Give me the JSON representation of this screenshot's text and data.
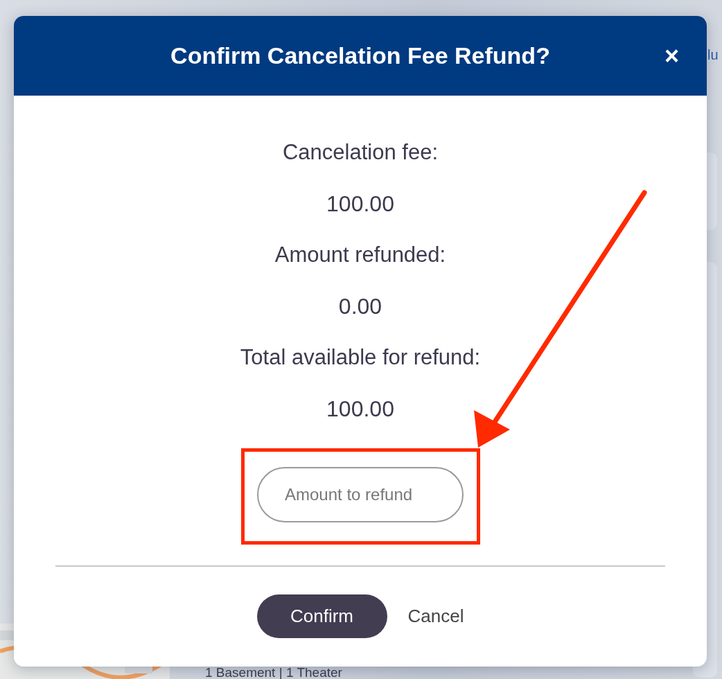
{
  "background_page": {
    "edge_link": "lu",
    "bottom_text": "1 Basement | 1 Theater"
  },
  "dialog": {
    "title": "Confirm Cancelation Fee Refund?",
    "close": "×",
    "lines": [
      {
        "kind": "label",
        "text": "Cancelation fee:"
      },
      {
        "kind": "value",
        "text": "100.00"
      },
      {
        "kind": "label",
        "text": "Amount refunded:"
      },
      {
        "kind": "value",
        "text": "0.00"
      },
      {
        "kind": "label",
        "text": "Total available for refund:"
      },
      {
        "kind": "value",
        "text": "100.00"
      }
    ],
    "refund_field": {
      "placeholder": "Amount to refund"
    },
    "buttons": [
      {
        "kind": "primary",
        "label": "Confirm"
      },
      {
        "kind": "link",
        "label": "Cancel"
      }
    ]
  },
  "annotation": {
    "kind": "box-with-arrow"
  }
}
